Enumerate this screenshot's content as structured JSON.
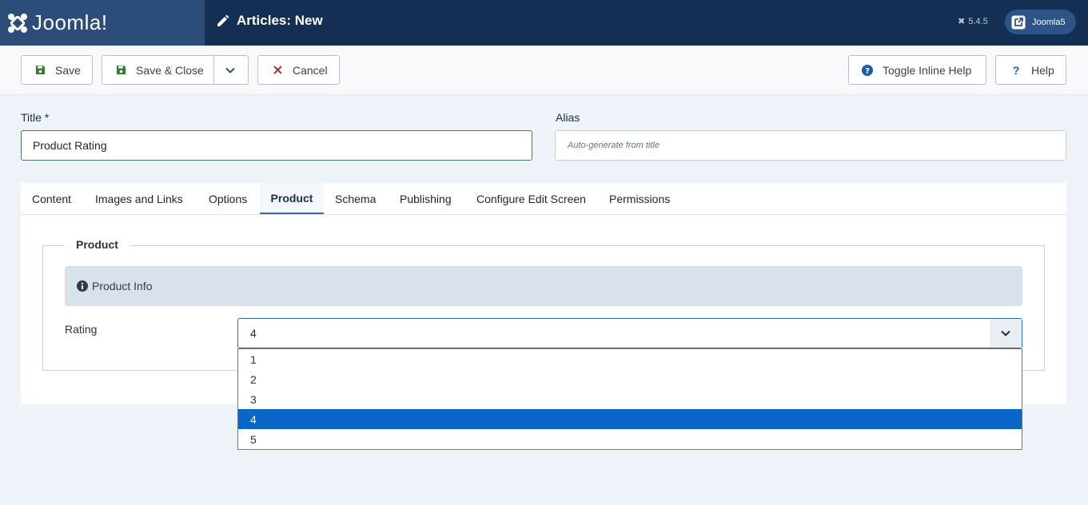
{
  "header": {
    "logo_text": "Joomla!",
    "page_title": "Articles: New",
    "version": "5.4.5",
    "user_label": "Joomla5"
  },
  "toolbar": {
    "save": "Save",
    "save_close": "Save & Close",
    "cancel": "Cancel",
    "toggle_help": "Toggle Inline Help",
    "help": "Help"
  },
  "form": {
    "title_label": "Title *",
    "title_value": "Product Rating",
    "alias_label": "Alias",
    "alias_placeholder": "Auto-generate from title"
  },
  "tabs": [
    {
      "label": "Content"
    },
    {
      "label": "Images and Links"
    },
    {
      "label": "Options"
    },
    {
      "label": "Product"
    },
    {
      "label": "Schema"
    },
    {
      "label": "Publishing"
    },
    {
      "label": "Configure Edit Screen"
    },
    {
      "label": "Permissions"
    }
  ],
  "active_tab": "Product",
  "product": {
    "legend": "Product",
    "info_text": "Product Info",
    "rating_label": "Rating",
    "rating_value": "4",
    "options": [
      "1",
      "2",
      "3",
      "4",
      "5"
    ],
    "selected_option": "4"
  },
  "colors": {
    "header_bg": "#132f53",
    "logo_bg": "#2b4d77",
    "accent": "#0a67c8",
    "save_icon": "#2f7d32",
    "cancel_icon": "#c52827",
    "help_icon": "#1c5ea6"
  }
}
